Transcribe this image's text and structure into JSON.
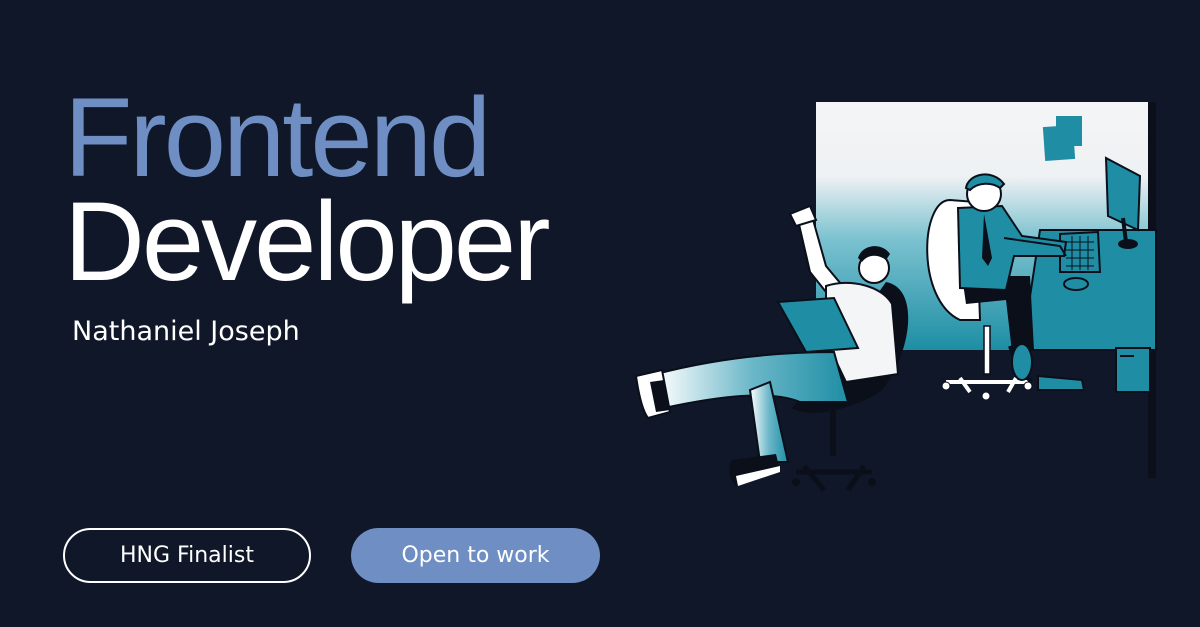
{
  "headline": {
    "line1": "Frontend",
    "line2": "Developer"
  },
  "name": "Nathaniel Joseph",
  "badges": {
    "finalist": "HNG Finalist",
    "status": "Open to work"
  },
  "colors": {
    "background": "#101729",
    "accent": "#6f8fc4",
    "teal": "#1f8ea5",
    "text": "#ffffff"
  },
  "illustration": {
    "icon": "office-developers-illustration"
  }
}
